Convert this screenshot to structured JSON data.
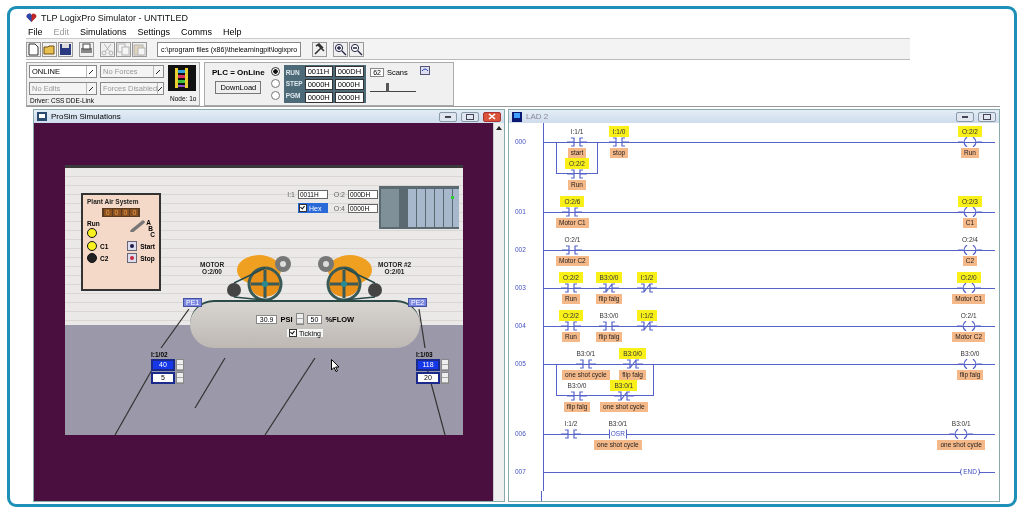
{
  "window": {
    "title": "TLP LogixPro Simulator  -  UNTITLED"
  },
  "menu": [
    {
      "label": "File",
      "disabled": false
    },
    {
      "label": "Edit",
      "disabled": true
    },
    {
      "label": "Simulations",
      "disabled": false
    },
    {
      "label": "Settings",
      "disabled": false
    },
    {
      "label": "Comms",
      "disabled": false
    },
    {
      "label": "Help",
      "disabled": false
    }
  ],
  "toolbar": {
    "tools": [
      {
        "kind": "new",
        "disabled": false
      },
      {
        "kind": "open",
        "disabled": false
      },
      {
        "kind": "save",
        "disabled": false
      },
      {
        "kind": "print",
        "disabled": false
      },
      {
        "kind": "cut",
        "disabled": true
      },
      {
        "kind": "copy",
        "disabled": true
      },
      {
        "kind": "paste",
        "disabled": true
      }
    ],
    "path": "c:\\program files (x86)\\thelearningpit\\logixpro",
    "actions": [
      {
        "kind": "tools"
      },
      {
        "kind": "zoom_in"
      },
      {
        "kind": "zoom_out"
      }
    ]
  },
  "plc_bar": {
    "dropdowns": [
      {
        "value": "ONLINE",
        "disabled": false
      },
      {
        "value": "No Forces",
        "disabled": true
      },
      {
        "value": "No Edits",
        "disabled": true
      },
      {
        "value": "Forces Disabled",
        "disabled": true
      }
    ],
    "driver": "Driver: CSS DDE-Link",
    "node": "Node: 1o",
    "status": "PLC = OnLine",
    "download": "DownLoad",
    "modes": [
      {
        "label": "RUN",
        "selected": true
      },
      {
        "label": "STEP",
        "selected": false
      },
      {
        "label": "PGM",
        "selected": false
      }
    ],
    "registers": [
      "0011H",
      "000DH",
      "0000H",
      "0000H",
      "0000H",
      "0000H"
    ],
    "scans": "62",
    "scans_label": "Scans",
    "speed": {
      "level": 0.35
    }
  },
  "prosim": {
    "title": "ProSim Simulations",
    "plant_panel": {
      "title": "Plant Air System",
      "display": [
        "0",
        "0",
        "0",
        "0"
      ],
      "run_lamp": {
        "label": "Run",
        "on": true
      },
      "selector": [
        "A",
        "B",
        "C"
      ],
      "lamps": [
        {
          "label": "C1",
          "on": true
        },
        {
          "label": "C2",
          "on": false
        }
      ],
      "buttons": [
        {
          "label": "Start",
          "color": "#1c1c48"
        },
        {
          "label": "Stop",
          "color": "#c8283c"
        }
      ]
    },
    "io": [
      {
        "label": "I:1",
        "value": "0011H"
      },
      {
        "label": "O:2",
        "value": "000DH"
      },
      {
        "label": "O:4",
        "value": "0000H"
      }
    ],
    "hex": {
      "label": "Hex",
      "checked": true
    },
    "motors": [
      {
        "label": "MOTOR",
        "address": "O:2/00"
      },
      {
        "label": "MOTOR #2",
        "address": "O:2/01"
      }
    ],
    "tank": {
      "psi": "30.9",
      "psi_unit": "PSI",
      "flow": "50",
      "flow_unit": "%FLOW",
      "ticking": {
        "label": "Ticking",
        "checked": true
      }
    },
    "sensors": [
      {
        "tag": "PE1",
        "address": "I:1/02",
        "values": [
          {
            "value": "40",
            "selected": true
          },
          {
            "value": "5",
            "selected": false
          }
        ]
      },
      {
        "tag": "PE2",
        "address": "I:1/03",
        "values": [
          {
            "value": "118",
            "selected": true
          },
          {
            "value": "20",
            "selected": false
          }
        ]
      }
    ]
  },
  "ladder": {
    "title": "LAD 2",
    "rungs": [
      {
        "number": "000",
        "branch": [
          [
            {
              "kind": "contact",
              "address": "I:1/1",
              "tag": "start",
              "energized": false
            }
          ],
          [
            {
              "kind": "contact",
              "address": "O:2/2",
              "tag": "Run",
              "energized": true
            }
          ]
        ],
        "series": [
          {
            "kind": "contact",
            "address": "I:1/0",
            "tag": "stop",
            "energized": true
          }
        ],
        "output": {
          "kind": "coil",
          "address": "O:2/2",
          "tag": "Run",
          "energized": true
        }
      },
      {
        "number": "001",
        "series": [
          {
            "kind": "contact",
            "address": "O:2/6",
            "tag": "Motor C1",
            "energized": true
          }
        ],
        "output": {
          "kind": "coil",
          "address": "O:2/3",
          "tag": "C1",
          "energized": true
        }
      },
      {
        "number": "002",
        "series": [
          {
            "kind": "contact",
            "address": "O:2/1",
            "tag": "Motor C2",
            "energized": false
          }
        ],
        "output": {
          "kind": "coil",
          "address": "O:2/4",
          "tag": "C2",
          "energized": false
        }
      },
      {
        "number": "003",
        "series": [
          {
            "kind": "contact",
            "address": "O:2/2",
            "tag": "Run",
            "energized": true
          },
          {
            "kind": "contact_nc",
            "address": "B3:0/0",
            "tag": "flip falg",
            "energized": true
          },
          {
            "kind": "contact_nc",
            "address": "I:1/2",
            "energized": true
          }
        ],
        "output": {
          "kind": "coil",
          "address": "O:2/0",
          "tag": "Motor C1",
          "energized": true
        }
      },
      {
        "number": "004",
        "series": [
          {
            "kind": "contact",
            "address": "O:2/2",
            "tag": "Run",
            "energized": true
          },
          {
            "kind": "contact",
            "address": "B3:0/0",
            "tag": "flip falg",
            "energized": false
          },
          {
            "kind": "contact_nc",
            "address": "I:1/2",
            "energized": true
          }
        ],
        "output": {
          "kind": "coil",
          "address": "O:2/1",
          "tag": "Motor C2",
          "energized": false
        }
      },
      {
        "number": "005",
        "branch": [
          [
            {
              "kind": "contact",
              "address": "B3:0/1",
              "tag": "one shot cycle",
              "energized": false
            },
            {
              "kind": "contact_nc",
              "address": "B3:0/0",
              "tag": "flip falg",
              "energized": true
            }
          ],
          [
            {
              "kind": "contact",
              "address": "B3:0/0",
              "tag": "flip falg",
              "energized": false
            },
            {
              "kind": "contact_nc",
              "address": "B3:0/1",
              "tag": "one shot cycle",
              "energized": true
            }
          ]
        ],
        "output": {
          "kind": "coil",
          "address": "B3:0/0",
          "tag": "flip falg",
          "energized": false
        }
      },
      {
        "number": "006",
        "series": [
          {
            "kind": "contact",
            "address": "I:1/2",
            "energized": false
          },
          {
            "kind": "osr",
            "text": "OSR",
            "address": "B3:0/1",
            "tag": "one shot cycle",
            "energized": false
          }
        ],
        "output": {
          "kind": "coil",
          "address": "B3:0/1",
          "tag": "one shot cycle",
          "energized": false
        }
      },
      {
        "number": "007",
        "output": {
          "kind": "end",
          "text": "END"
        }
      }
    ]
  }
}
